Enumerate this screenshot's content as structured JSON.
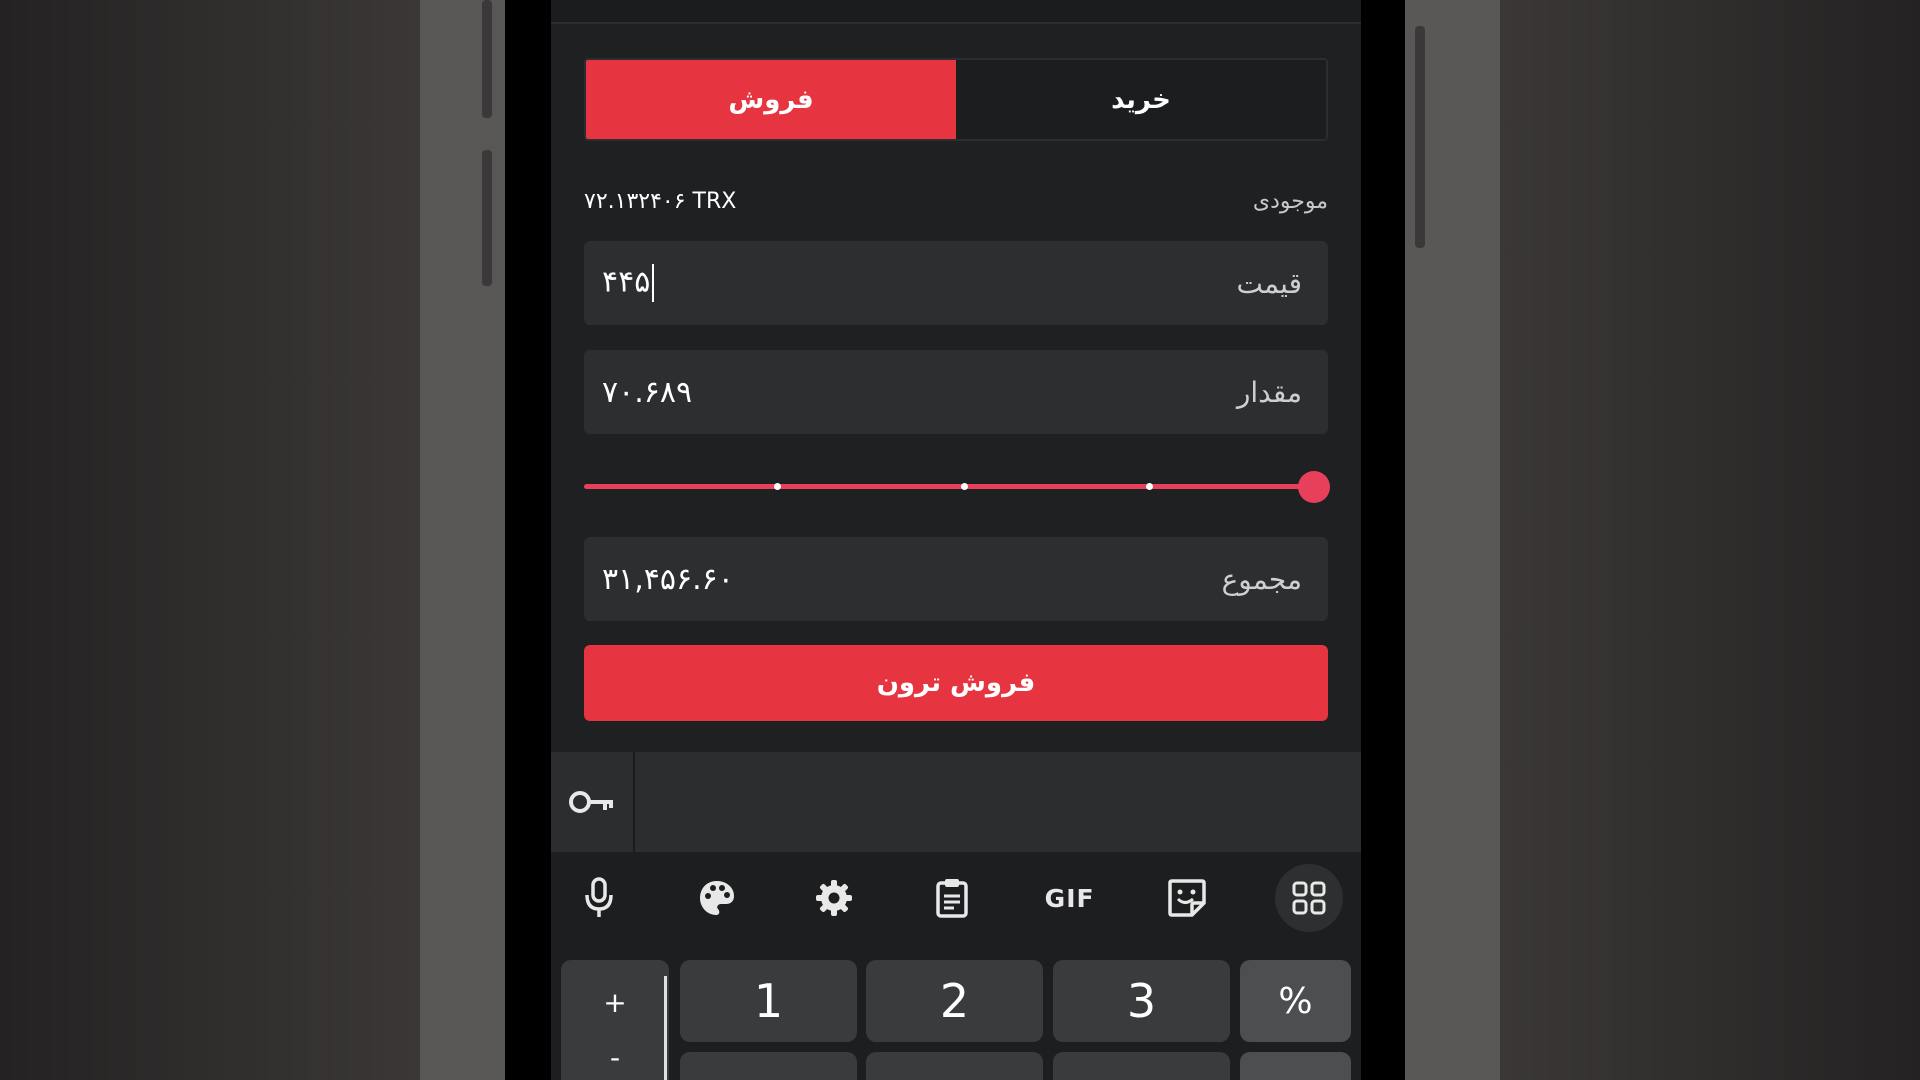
{
  "tabs": {
    "sell": "فروش",
    "buy": "خرید"
  },
  "balance": {
    "label": "موجودی",
    "value": "۷۲.۱۳۲۴۰۶ TRX"
  },
  "price": {
    "label": "قیمت",
    "value": "۴۴۵"
  },
  "amount": {
    "label": "مقدار",
    "value": "۷۰.۶۸۹"
  },
  "slider": {
    "level_percent": 100
  },
  "total": {
    "label": "مجموع",
    "value": "۳۱,۴۵۶.۶۰"
  },
  "submit": {
    "label": "فروش ترون"
  },
  "keyboard": {
    "gif_label": "GIF",
    "keys": [
      "1",
      "2",
      "3",
      "%"
    ],
    "plus": "+",
    "minus": "-",
    "tools": [
      "microphone-icon",
      "palette-icon",
      "gear-icon",
      "clipboard-icon",
      "GIF",
      "sticker-icon",
      "apps-grid-icon"
    ]
  },
  "colors": {
    "accent": "#e63540",
    "slider": "#e8405a",
    "background": "#1f2021",
    "field": "#2c2e2f"
  }
}
